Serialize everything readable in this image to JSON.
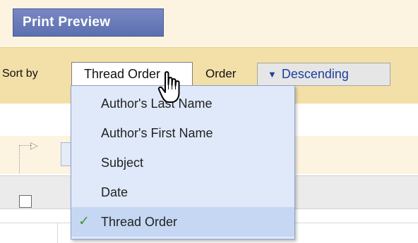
{
  "toolbar": {
    "print_preview_label": "Print Preview"
  },
  "sort_bar": {
    "sort_by_label": "Sort by",
    "sort_selected": "Thread Order",
    "order_label": "Order",
    "order_arrow_icon": "triangle-down-icon",
    "order_value": "Descending"
  },
  "sort_menu": {
    "options": [
      {
        "label": "Author's Last Name",
        "selected": false
      },
      {
        "label": "Author's First Name",
        "selected": false
      },
      {
        "label": "Subject",
        "selected": false
      },
      {
        "label": "Date",
        "selected": false
      },
      {
        "label": "Thread Order",
        "selected": true
      }
    ],
    "check_icon": "checkmark-icon"
  },
  "colors": {
    "print_button": "#6a7cbb",
    "sort_bar_bg": "#f3dfa8",
    "menu_bg": "#dfe9fa",
    "menu_selected_bg": "#c5d7f3",
    "order_text": "#1d3f9c",
    "check": "#3c9a34"
  }
}
